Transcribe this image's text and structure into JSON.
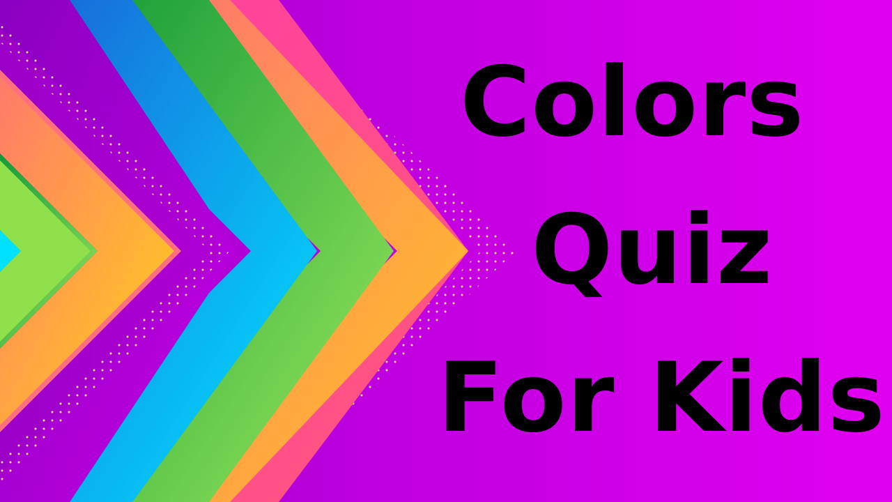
{
  "title": {
    "line_1": "Colors",
    "line_2": "Quiz",
    "line_3": "For Kids"
  },
  "colors": {
    "background": "#c800e6",
    "text": "#000000",
    "dots": "#f2e36b",
    "chevrons": [
      "#ff3fa0",
      "#ff7a6a",
      "#1aa23a",
      "#8fe04b",
      "#1a6fd6",
      "#00c8f0",
      "#b100d6",
      "#ff6f80",
      "#ffd21a",
      "#5fd04a",
      "#00e0ff"
    ]
  },
  "decoration": {
    "shape": "nested-chevrons-with-dot-pattern"
  }
}
